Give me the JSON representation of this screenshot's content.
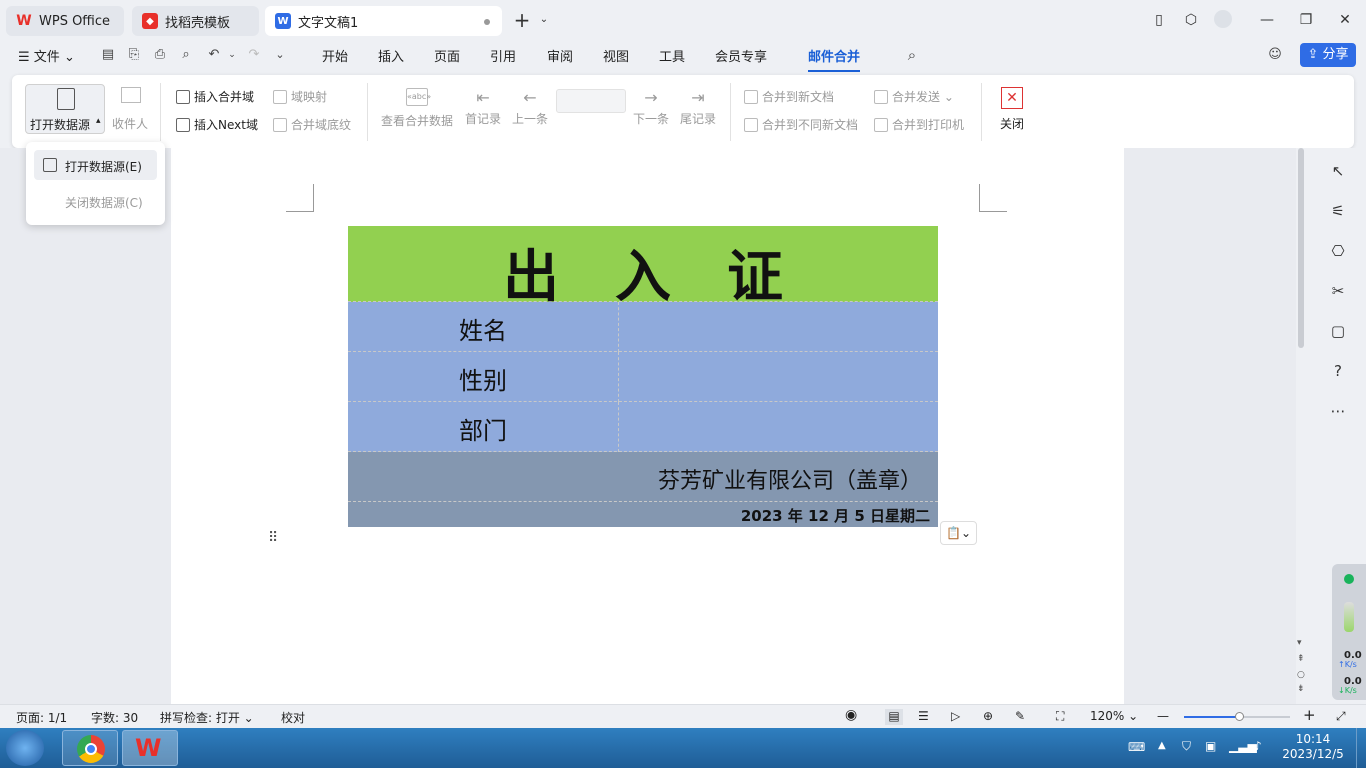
{
  "tabs": [
    {
      "label": "WPS Office",
      "icon": "wps-logo-icon",
      "color": "#e8302a"
    },
    {
      "label": "找稻壳模板",
      "icon": "docer-icon",
      "color": "#e8302a"
    },
    {
      "label": "文字文稿1",
      "icon": "writer-doc-icon",
      "color": "#2f6ce5"
    }
  ],
  "menu": {
    "file": "文件",
    "items": [
      "开始",
      "插入",
      "页面",
      "引用",
      "审阅",
      "视图",
      "工具",
      "会员专享",
      "邮件合并"
    ],
    "active": "邮件合并",
    "share": "分享"
  },
  "ribbon": {
    "open_datasource": "打开数据源",
    "recipients": "收件人",
    "insert_merge_field": "插入合并域",
    "field_mapping": "域映射",
    "insert_next": "插入Next域",
    "merge_field_shading": "合并域底纹",
    "view_merged_data": "查看合并数据",
    "first_record": "首记录",
    "prev_record": "上一条",
    "next_record": "下一条",
    "last_record": "尾记录",
    "merge_to_new_doc": "合并到新文档",
    "merge_send": "合并发送",
    "merge_to_diff_docs": "合并到不同新文档",
    "merge_to_printer": "合并到打印机",
    "close": "关闭"
  },
  "dropdown": {
    "open": "打开数据源(E)",
    "close": "关闭数据源(C)"
  },
  "document": {
    "title": "出　入　证",
    "fields": [
      "姓名",
      "性别",
      "部门"
    ],
    "company": "芬芳矿业有限公司（盖章）",
    "date": "2023 年 12 月 5 日星期二"
  },
  "colors": {
    "title_bg": "#92d050",
    "field_bg": "#8faadc",
    "footer_bg": "#8497b0",
    "accent": "#1a5fd6",
    "share_bg": "#2f6ce5"
  },
  "status": {
    "page": "页面: 1/1",
    "words": "字数: 30",
    "spell": "拼写检查: 打开",
    "proof": "校对",
    "zoom": "120%"
  },
  "net": {
    "up_value": "0.0",
    "up_unit": "K/s",
    "down_value": "0.0",
    "down_unit": "K/s"
  },
  "taskbar": {
    "time": "10:14",
    "date": "2023/12/5"
  }
}
